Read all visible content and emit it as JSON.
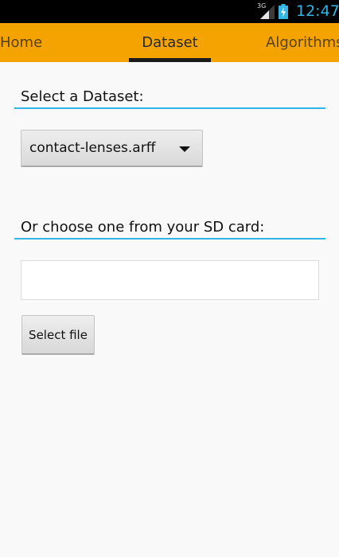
{
  "status_bar": {
    "network_type": "3G",
    "time": "12:47",
    "icons": [
      "signal-icon",
      "battery-charging-icon"
    ]
  },
  "tabs": [
    {
      "label": "Home",
      "selected": false
    },
    {
      "label": "Dataset",
      "selected": true
    },
    {
      "label": "Algorithms",
      "selected": false
    }
  ],
  "colors": {
    "action_bar": "#f4a300",
    "accent": "#33b5e5",
    "status_bar": "#000000",
    "background": "#f9f9f9"
  },
  "dataset_section": {
    "header": "Select a Dataset:",
    "selected_dataset": "contact-lenses.arff"
  },
  "sd_card_section": {
    "header": "Or choose one from your SD card:",
    "file_path_value": "",
    "select_button_label": "Select file"
  }
}
